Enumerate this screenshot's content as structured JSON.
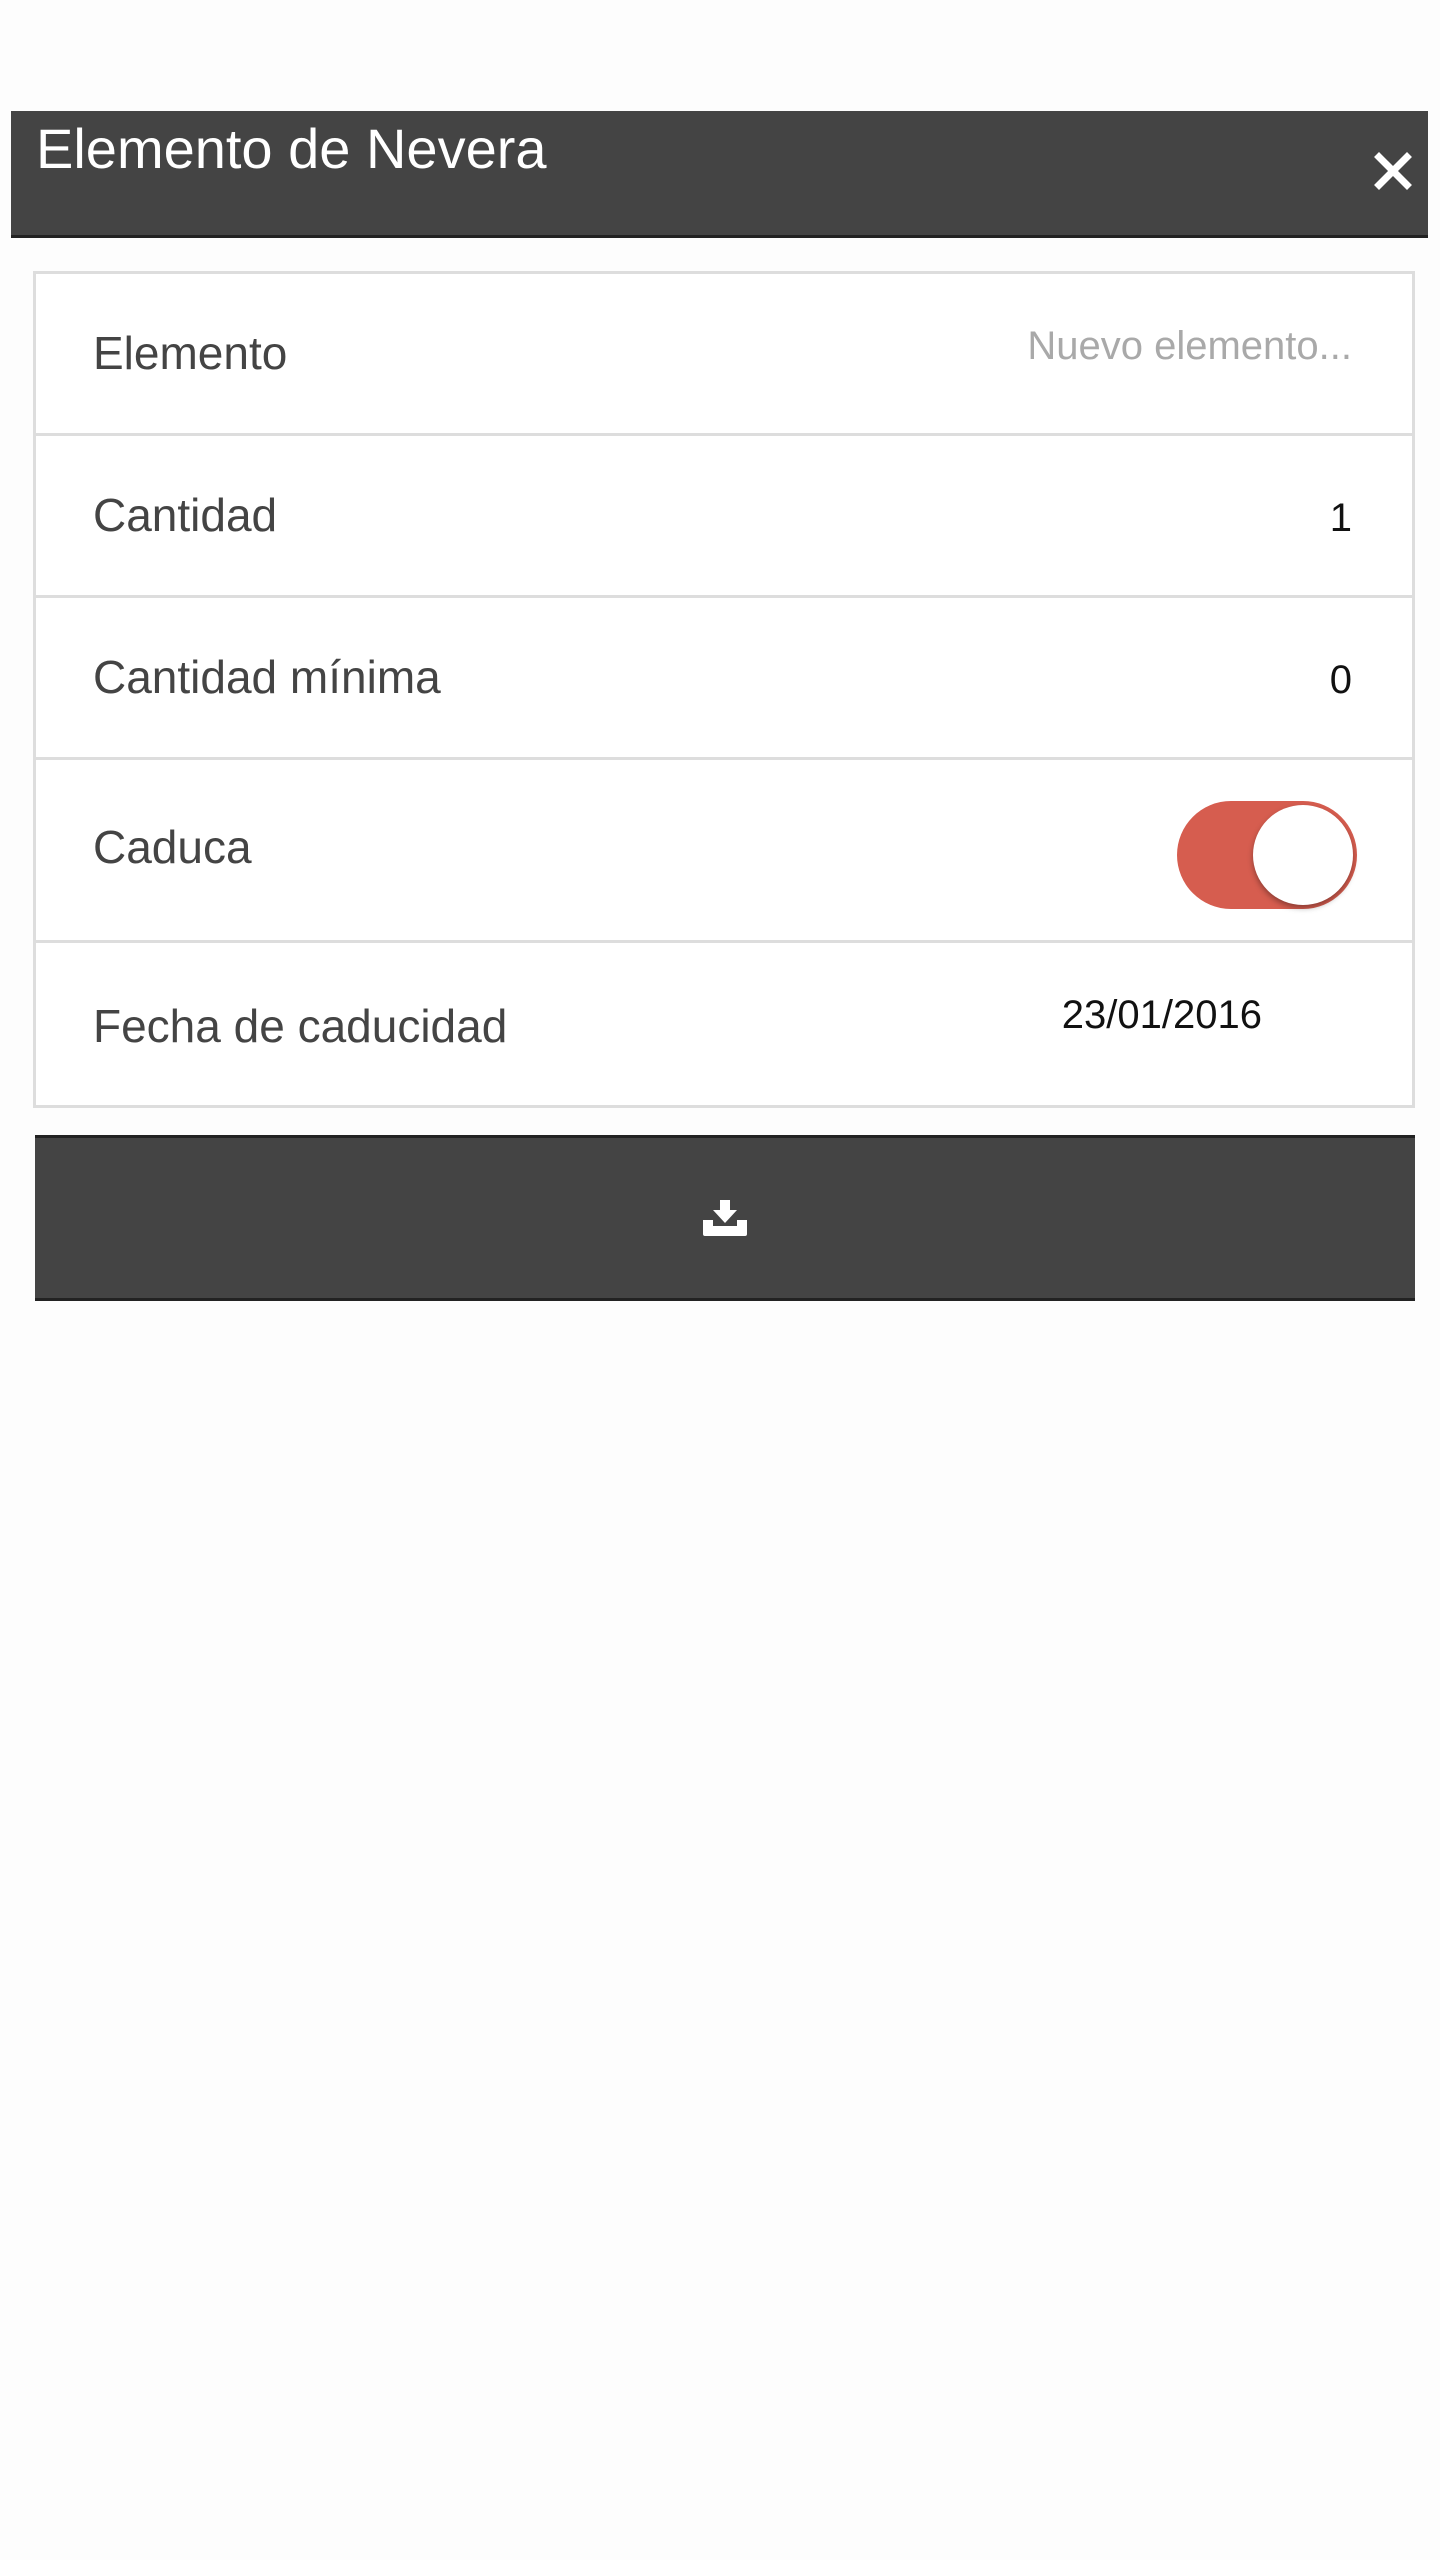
{
  "header": {
    "title": "Elemento de Nevera",
    "close_icon": "close-icon"
  },
  "form": {
    "elemento": {
      "label": "Elemento",
      "value": "",
      "placeholder": "Nuevo elemento..."
    },
    "cantidad": {
      "label": "Cantidad",
      "value": "1"
    },
    "cantidad_minima": {
      "label": "Cantidad mínima",
      "value": "0"
    },
    "caduca": {
      "label": "Caduca",
      "checked": true
    },
    "fecha_caducidad": {
      "label": "Fecha de caducidad",
      "value": "23/01/2016"
    }
  },
  "save_button": {
    "icon": "download-icon"
  },
  "colors": {
    "header_bg": "#444444",
    "toggle_on": "#d65d4f",
    "row_border": "#dddddd",
    "page_bg": "#fdfdfd"
  }
}
